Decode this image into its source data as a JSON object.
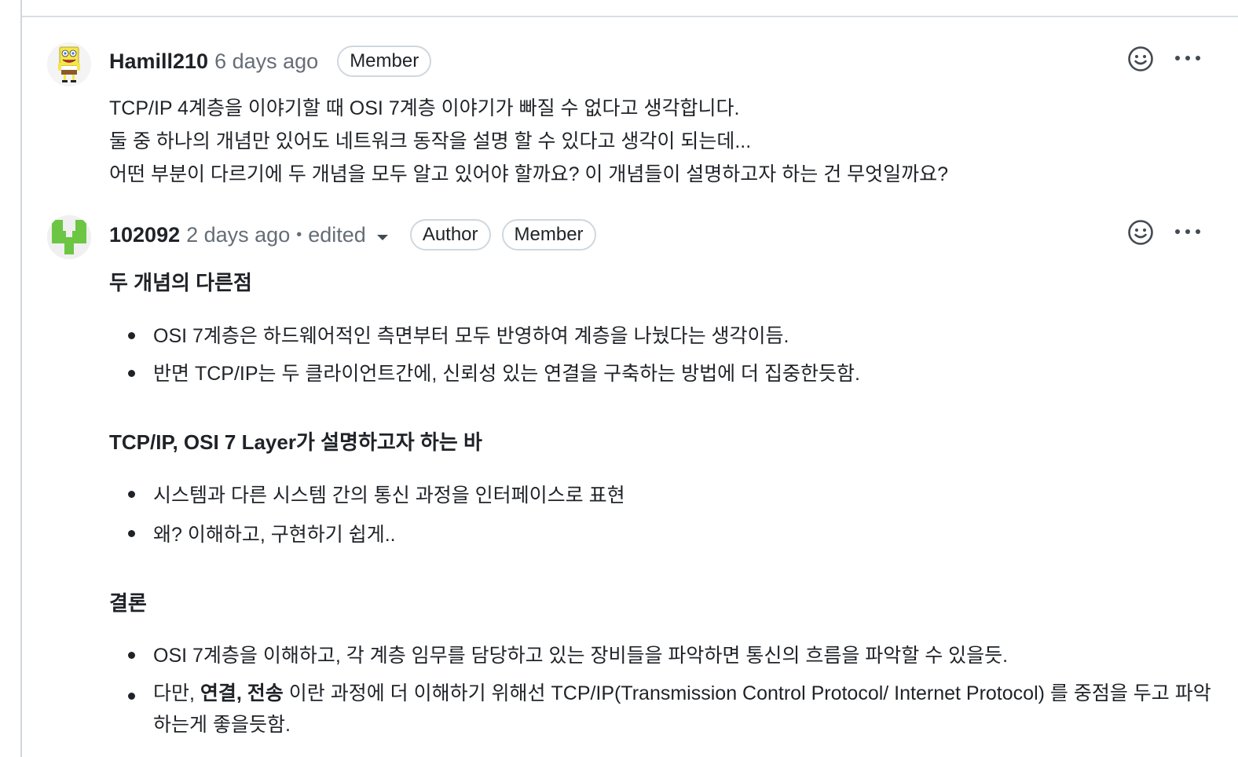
{
  "comments": [
    {
      "author": "Hamill210",
      "timestamp": "6 days ago",
      "badges": [
        "Member"
      ],
      "body_lines": [
        "TCP/IP 4계층을 이야기할 때 OSI 7계층 이야기가 빠질 수 없다고 생각합니다.",
        "둘 중 하나의 개념만 있어도 네트워크 동작을 설명 할 수 있다고 생각이 되는데...",
        "어떤 부분이 다르기에 두 개념을 모두 알고 있어야 할까요? 이 개념들이 설명하고자 하는 건 무엇일까요?"
      ]
    },
    {
      "author": "102092",
      "timestamp": "2 days ago",
      "edited_separator": "•",
      "edited_label": "edited",
      "badges": [
        "Author",
        "Member"
      ],
      "sections": [
        {
          "heading": "두 개념의 다른점",
          "items": [
            "OSI 7계층은 하드웨어적인 측면부터 모두 반영하여 계층을 나눴다는 생각이듬.",
            "반면 TCP/IP는 두 클라이언트간에, 신뢰성 있는 연결을 구축하는 방법에 더 집중한듯함."
          ]
        },
        {
          "heading": "TCP/IP, OSI 7 Layer가 설명하고자 하는 바",
          "items": [
            "시스템과 다른 시스템 간의 통신 과정을 인터페이스로 표현",
            "왜? 이해하고, 구현하기 쉽게.."
          ]
        },
        {
          "heading": "결론",
          "items": [
            "OSI 7계층을 이해하고, 각 계층 임무를 담당하고 있는 장비들을 파악하면 통신의 흐름을 파악할 수 있을듯."
          ],
          "last_item": {
            "prefix": "다만, ",
            "bold": "연결, 전송",
            "suffix": " 이란 과정에 더 이해하기 위해선 TCP/IP(Transmission Control Protocol/ Internet Protocol) 를 중점을 두고 파악하는게 좋을듯함."
          }
        }
      ]
    }
  ],
  "icons": {
    "reaction": "smiley-icon",
    "menu": "kebab-horizontal-icon",
    "dropdown": "triangle-down-icon",
    "avatar1": "spongebob-avatar",
    "avatar2": "identicon-avatar"
  },
  "colors": {
    "text": "#1f2328",
    "muted": "#656d76",
    "border": "#d0d7de",
    "identicon": "#6cc644"
  }
}
